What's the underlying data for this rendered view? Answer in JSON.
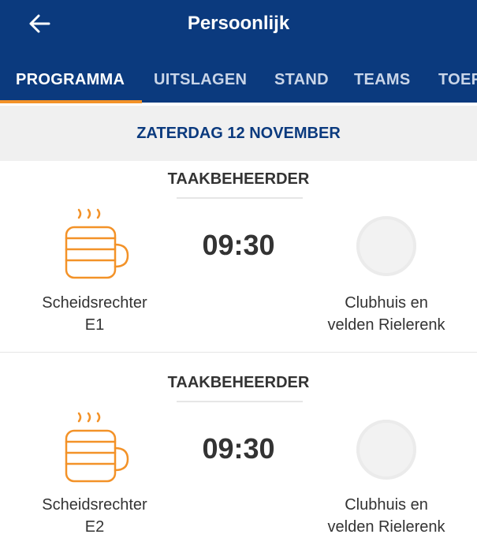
{
  "header": {
    "title": "Persoonlijk",
    "back_icon": "arrow-left-icon"
  },
  "tabs": [
    {
      "label": "PROGRAMMA",
      "active": true
    },
    {
      "label": "UITSLAGEN",
      "active": false
    },
    {
      "label": "STAND",
      "active": false
    },
    {
      "label": "TEAMS",
      "active": false
    },
    {
      "label": "TOER",
      "active": false
    }
  ],
  "date_label": "ZATERDAG 12 NOVEMBER",
  "items": [
    {
      "header": "TAAKBEHEERDER",
      "time": "09:30",
      "role_line1": "Scheidsrechter",
      "role_line2": "E1",
      "location_line1": "Clubhuis en",
      "location_line2": "velden Rielerenk",
      "icon": "coffee-cup-icon"
    },
    {
      "header": "TAAKBEHEERDER",
      "time": "09:30",
      "role_line1": "Scheidsrechter",
      "role_line2": "E2",
      "location_line1": "Clubhuis en",
      "location_line2": "velden Rielerenk",
      "icon": "coffee-cup-icon"
    }
  ],
  "colors": {
    "header_bg": "#0b3a7e",
    "accent": "#f39228",
    "date_text": "#0b3a7e"
  }
}
